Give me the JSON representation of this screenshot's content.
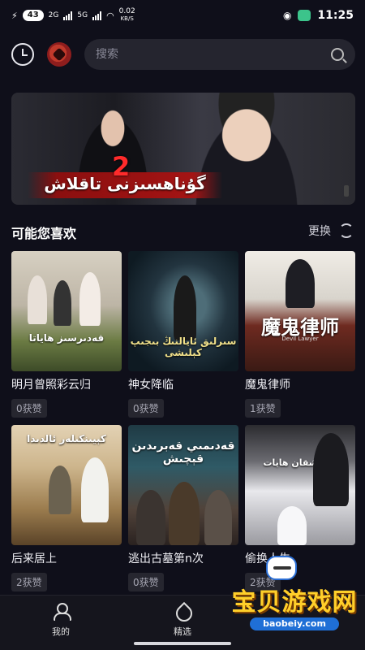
{
  "status_bar": {
    "battery_level": "43",
    "network_2g": "2G",
    "network_5g": "5G",
    "data_speed": "0.02",
    "data_unit": "KB/S",
    "time": "11:25"
  },
  "header": {
    "search_placeholder": "搜索"
  },
  "banner": {
    "title": "گۇناھسىزنى تاقلاش",
    "number": "2"
  },
  "section": {
    "title": "可能您喜欢",
    "refresh_label": "更换"
  },
  "dramas": [
    {
      "name": "明月曾照彩云归",
      "likes": "0获赞",
      "poster_title": "قەدىرسىز ھاياتا"
    },
    {
      "name": "神女降临",
      "likes": "0获赞",
      "poster_title": "سىرلىق ئايالنىڭ بىجىپ كېلىشى"
    },
    {
      "name": "魔鬼律师",
      "likes": "1获赞",
      "poster_title": "魔鬼律师",
      "poster_subtitle": "Devil Lawyer"
    },
    {
      "name": "后来居上",
      "likes": "2获赞",
      "poster_title": "كېيىنكىلەر ئالدىدا"
    },
    {
      "name": "逃出古墓第n次",
      "likes": "0获赞",
      "poster_title": "قەدىمىي قەبرىدىن قېچىش"
    },
    {
      "name": "偷换人生",
      "likes": "2获赞",
      "poster_title": "ئالماشقان ھايات"
    }
  ],
  "bottom_nav": {
    "mine": "我的",
    "featured": "精选"
  },
  "watermark": {
    "text": "宝贝游戏网",
    "url": "baobeiy.com"
  }
}
